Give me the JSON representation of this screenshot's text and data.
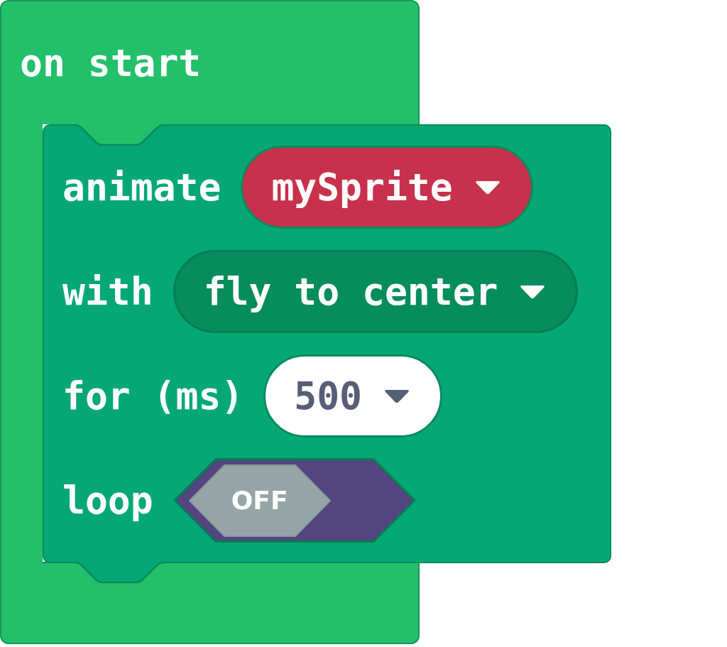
{
  "on_start_block": {
    "label": "on start",
    "statements": [
      {
        "rows": [
          {
            "kind": "variable",
            "label": "animate",
            "value": "mySprite"
          },
          {
            "kind": "dropdown",
            "label": "with",
            "value": "fly to center"
          },
          {
            "kind": "number",
            "label": "for (ms)",
            "value": "500"
          },
          {
            "kind": "toggle",
            "label": "loop",
            "on": false,
            "value": "OFF"
          }
        ]
      }
    ]
  }
}
